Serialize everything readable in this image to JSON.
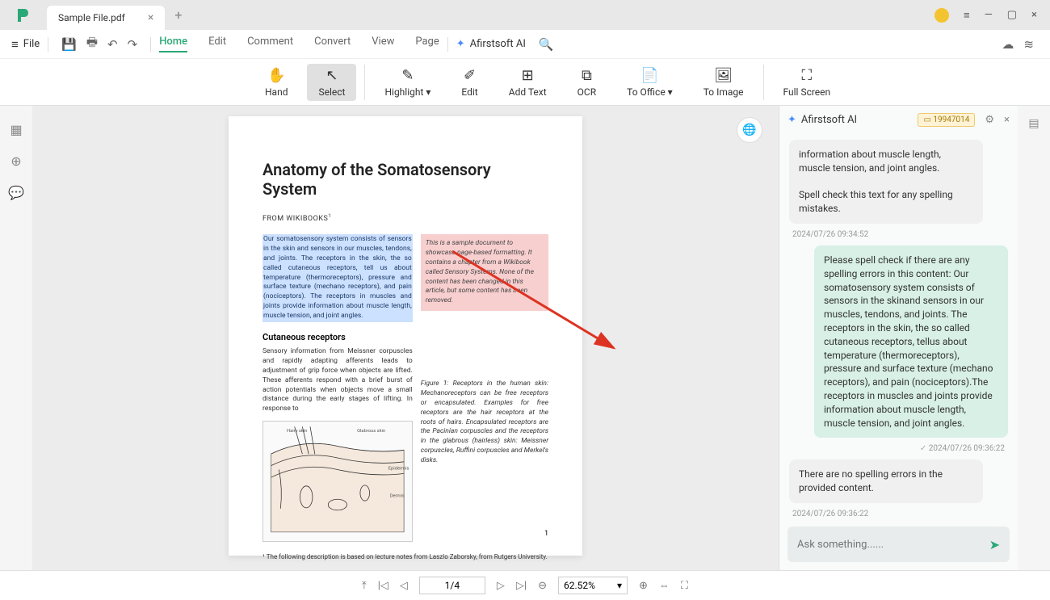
{
  "titlebar": {
    "tab_name": "Sample File.pdf"
  },
  "menubar": {
    "file": "File",
    "tabs": [
      "Home",
      "Edit",
      "Comment",
      "Convert",
      "View",
      "Page"
    ],
    "active": "Home",
    "ai_label": "Afirstsoft AI"
  },
  "toolbar": {
    "hand": "Hand",
    "select": "Select",
    "highlight": "Highlight",
    "edit": "Edit",
    "addtext": "Add Text",
    "ocr": "OCR",
    "tooffice": "To Office",
    "toimage": "To Image",
    "fullscreen": "Full Screen"
  },
  "doc": {
    "title": "Anatomy of the Somatosensory System",
    "from": "FROM WIKIBOOKS",
    "para_hl": "Our somatosensory system consists of sensors in the skin and sensors in our muscles, tendons, and joints. The receptors in the skin, the so called cutaneous receptors, tell us about temperature (thermoreceptors), pressure and surface texture (mechano receptors), and pain (nociceptors). The receptors in muscles and joints provide information about muscle length, muscle tension, and joint angles.",
    "sidebox": "This is a sample document to showcase page-based formatting. It contains a chapter from a Wikibook called Sensory Systems. None of the content has been changed in this article, but some content has been removed.",
    "sub": "Cutaneous receptors",
    "para2": "Sensory information from Meissner corpuscles and rapidly adapting afferents leads to adjustment of grip force when objects are lifted. These afferents respond with a brief burst of action potentials when objects move a small distance during the early stages of lifting. In response to",
    "figcap": "Figure 1: Receptors in the human skin: Mechanoreceptors can be free receptors or encapsulated. Examples for free receptors are the hair receptors at the roots of hairs. Encapsulated receptors are the Pacinian corpuscles and the receptors in the glabrous (hairless) skin: Meissner corpuscles, Ruffini corpuscles and Merkel's disks.",
    "footnote": "¹ The following description is based on lecture notes from Laszlo Zaborsky, from Rutgers University.",
    "pagenum": "1"
  },
  "ai": {
    "title": "Afirstsoft AI",
    "credits": "19947014",
    "msg1": "information about muscle length, muscle tension, and joint angles.\n\nSpell check this text for any spelling mistakes.",
    "ts1": "2024/07/26 09:34:52",
    "msg2": "Please spell check if there are any spelling errors in this content: Our somatosensory system consists of sensors in the skinand sensors in our muscles, tendons, and joints. The receptors in the skin, the so called cutaneous receptors, tellus about temperature (thermoreceptors), pressure and surface texture (mechano receptors), and pain (nociceptors).The receptors in muscles and joints provide information about muscle length, muscle tension, and joint angles.",
    "ts2": "2024/07/26 09:36:22",
    "msg3": "There are no spelling errors in the provided content.",
    "ts3": "2024/07/26 09:36:22",
    "placeholder": "Ask something......"
  },
  "status": {
    "page": "1/4",
    "zoom": "62.52%"
  }
}
